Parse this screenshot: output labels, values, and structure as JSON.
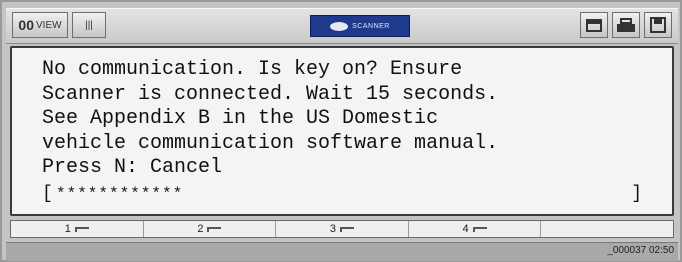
{
  "toolbar": {
    "view_label": "VIEW",
    "view_glyph": "00",
    "menu_glyph": "|||",
    "brand_text": "SCANNER"
  },
  "message": {
    "lines": [
      "No communication. Is key on? Ensure",
      "Scanner is connected. Wait 15 seconds.",
      "See Appendix B in the US Domestic",
      "vehicle communication software manual.",
      "Press N: Cancel"
    ]
  },
  "progress": {
    "left_bracket": "[",
    "fill": "************",
    "right_bracket": "]"
  },
  "function_keys": [
    {
      "label": "1"
    },
    {
      "label": "2"
    },
    {
      "label": "3"
    },
    {
      "label": "4"
    },
    {
      "label": ""
    }
  ],
  "status": {
    "time": "_000037  02:50"
  }
}
